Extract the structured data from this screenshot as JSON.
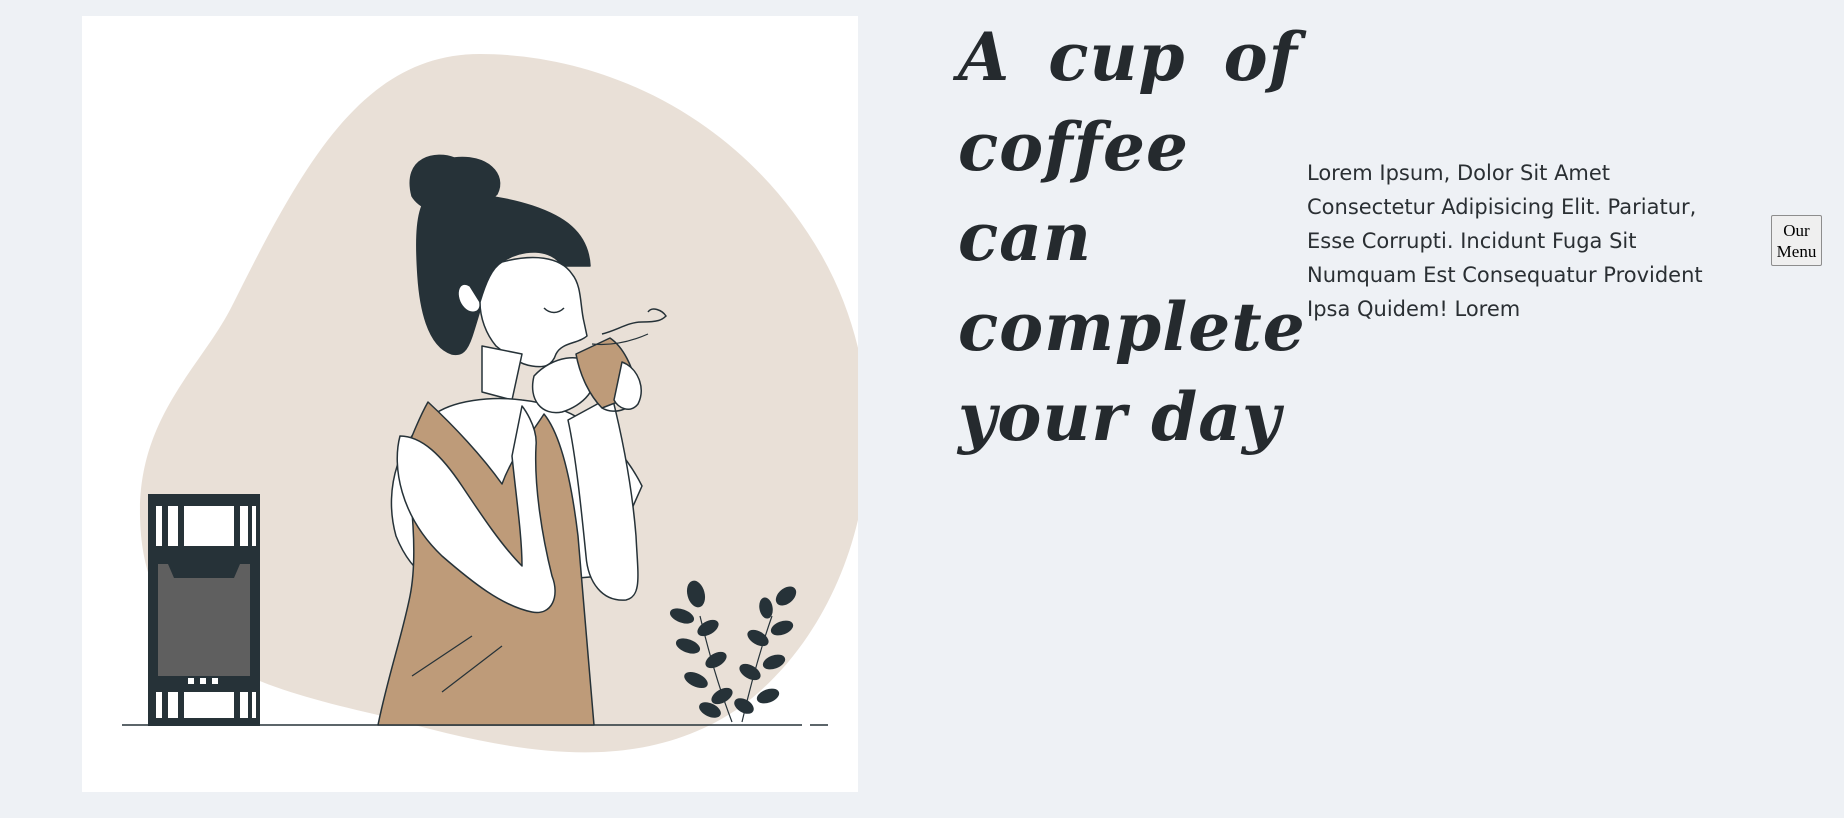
{
  "hero": {
    "illustration_icon": "woman-drinking-coffee-illustration",
    "colors": {
      "blob": "#e9e0d7",
      "dress": "#be9b79",
      "hair": "#263238",
      "machine_screen": "#5f5f5f"
    }
  },
  "headline": "A cup of coffee can complete your day",
  "description": "Lorem Ipsum, Dolor Sit Amet Consectetur Adipisicing Elit. Pariatur, Esse Corrupti. Incidunt Fuga Sit Numquam Est Consequatur Provident Ipsa Quidem! Lorem",
  "menu_button": {
    "label": "Our Menu"
  }
}
